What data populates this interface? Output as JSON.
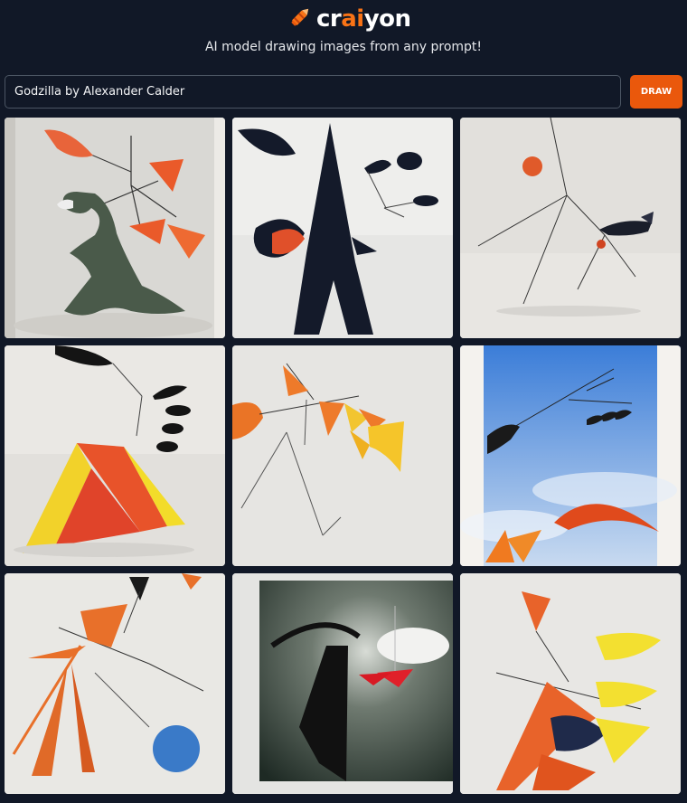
{
  "header": {
    "brand": {
      "prefix": "cr",
      "accent": "ai",
      "suffix": "yon"
    },
    "tagline": "AI model drawing images from any prompt!"
  },
  "search": {
    "value": "Godzilla by Alexander Calder",
    "button_label": "DRAW"
  },
  "colors": {
    "background": "#111827",
    "accent": "#ea580c",
    "brand_accent": "#f97316"
  },
  "icons": {
    "logo": "crayon-icon"
  },
  "gallery": {
    "rows": 3,
    "columns": 3,
    "images": [
      "calder-godzilla-1",
      "calder-godzilla-2",
      "calder-godzilla-3",
      "calder-godzilla-4",
      "calder-godzilla-5",
      "calder-godzilla-6",
      "calder-godzilla-7",
      "calder-godzilla-8",
      "calder-godzilla-9"
    ]
  }
}
